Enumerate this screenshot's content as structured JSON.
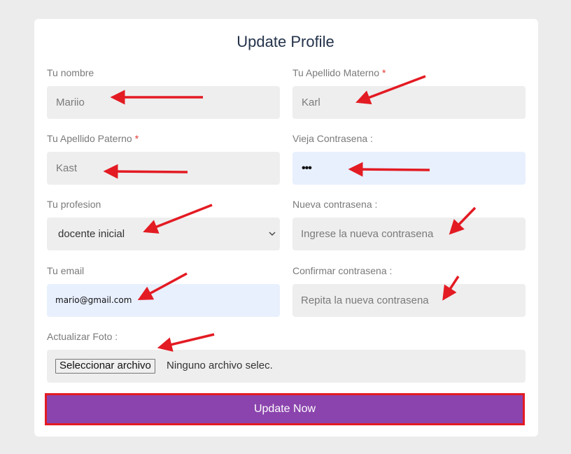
{
  "form": {
    "title": "Update Profile",
    "fields": {
      "nombre": {
        "label": "Tu nombre",
        "value": "Mariio"
      },
      "apellido_materno": {
        "label": "Tu Apellido Materno",
        "required_mark": "*",
        "value": "Karl"
      },
      "apellido_paterno": {
        "label": "Tu Apellido Paterno",
        "required_mark": "*",
        "value": "Kast"
      },
      "vieja_contrasena": {
        "label": "Vieja Contrasena :",
        "value": "•••"
      },
      "profesion": {
        "label": "Tu profesion",
        "value": "docente inicial"
      },
      "nueva_contrasena": {
        "label": "Nueva contrasena :",
        "placeholder": "Ingrese la nueva contrasena"
      },
      "email": {
        "label": "Tu email",
        "value": "mario@gmail.com"
      },
      "confirmar_contrasena": {
        "label": "Confirmar contrasena :",
        "placeholder": "Repita la nueva contrasena"
      },
      "foto": {
        "label": "Actualizar Foto :",
        "button_label": "Seleccionar archivo",
        "status_text": "Ninguno archivo selec."
      }
    },
    "submit_label": "Update Now"
  },
  "colors": {
    "page_background": "#ececec",
    "card_background": "#ffffff",
    "field_background": "#eeeeee",
    "autofill_background": "#e8f0fe",
    "button_background": "#8b44ad",
    "highlight_red": "#e31b23",
    "required_mark": "#e53935"
  },
  "icons": {
    "select_arrow": "chevron-down-icon",
    "annotation": "red-arrow-annotation"
  }
}
